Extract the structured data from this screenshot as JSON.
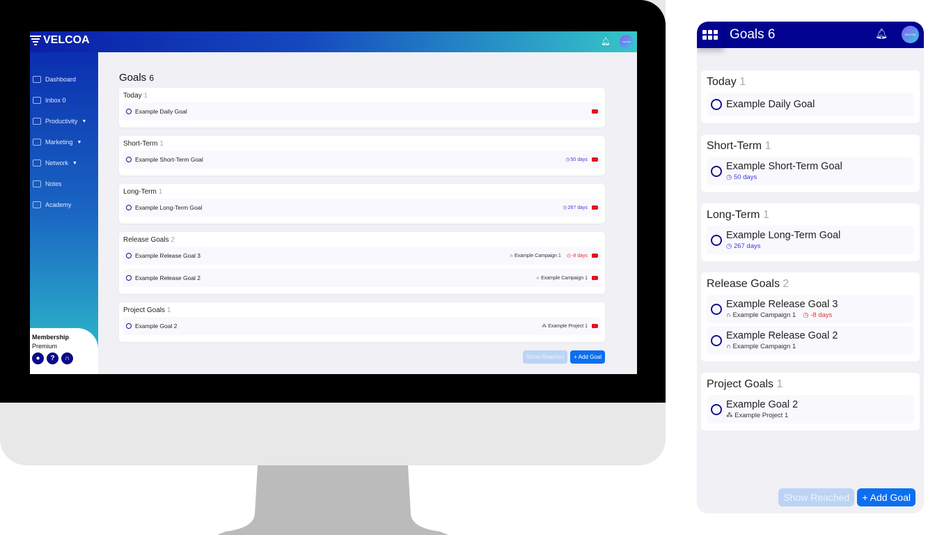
{
  "desktop": {
    "brand": "VELCOA",
    "avatar_text": "VELCOA",
    "sidebar": {
      "items": [
        {
          "label": "Dashboard",
          "icon": "monitor-icon"
        },
        {
          "label": "Inbox",
          "count": "0",
          "icon": "inbox-icon"
        },
        {
          "label": "Productivity",
          "icon": "checkbox-icon",
          "expandable": true
        },
        {
          "label": "Marketing",
          "icon": "megaphone-icon",
          "expandable": true
        },
        {
          "label": "Network",
          "icon": "users-icon",
          "expandable": true
        },
        {
          "label": "Notes",
          "icon": "note-icon"
        },
        {
          "label": "Academy",
          "icon": "graduation-cap-icon"
        }
      ],
      "membership_label": "Membership",
      "membership_value": "Premium"
    },
    "title": "Goals",
    "count": "6"
  },
  "sections": [
    {
      "title": "Today",
      "count": "1",
      "goals": [
        {
          "name": "Example Daily Goal"
        }
      ]
    },
    {
      "title": "Short-Term",
      "count": "1",
      "goals": [
        {
          "name": "Example Short-Term Goal",
          "days": "50 days"
        }
      ]
    },
    {
      "title": "Long-Term",
      "count": "1",
      "goals": [
        {
          "name": "Example Long-Term Goal",
          "days": "267 days"
        }
      ]
    },
    {
      "title": "Release Goals",
      "count": "2",
      "goals": [
        {
          "name": "Example Release Goal 3",
          "campaign": "Example Campaign 1",
          "days": "-8 days",
          "overdue": true
        },
        {
          "name": "Example Release Goal 2",
          "campaign": "Example Campaign 1"
        }
      ]
    },
    {
      "title": "Project Goals",
      "count": "1",
      "goals": [
        {
          "name": "Example Goal 2",
          "project": "Example Project 1"
        }
      ]
    }
  ],
  "buttons": {
    "show_reached": "Show Reached",
    "add_goal": "+ Add Goal"
  },
  "mobile": {
    "title": "Goals 6",
    "avatar_text": "VELCOA"
  },
  "colors": {
    "accent": "#0b6ff0",
    "navy": "#020490",
    "overdue": "#e03030",
    "days": "#3a3ad8"
  }
}
